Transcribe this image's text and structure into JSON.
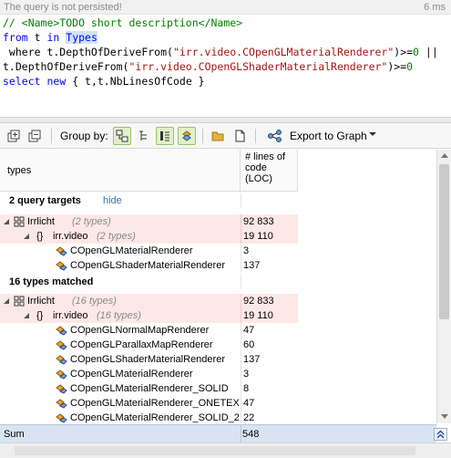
{
  "status": {
    "message": "The query is not persisted!",
    "time": "6 ms"
  },
  "editor": {
    "line1": {
      "comment": "// <Name>TODO short description</Name>"
    },
    "line2": {
      "kw_from": "from",
      "var_t": " t ",
      "kw_in": "in",
      "space": " ",
      "types_sel": "Types"
    },
    "line3": {
      "pre": " where t.DepthOfDeriveFrom(",
      "str": "\"irr.video.COpenGLMaterialRenderer\"",
      "op": ")>=",
      "num": "0",
      "post": " ||"
    },
    "line4": {
      "pre": "t.DepthOfDeriveFrom(",
      "str": "\"irr.video.COpenGLShaderMaterialRenderer\"",
      "op": ")>=",
      "num": "0"
    },
    "line5": {
      "kw_select": "select",
      "space1": " ",
      "kw_new": "new",
      "rest": " { t,t.NbLinesOfCode }"
    }
  },
  "toolbar": {
    "group_by_label": "Group by:",
    "export_label": "Export to Graph"
  },
  "grid": {
    "col_types": "types",
    "col_loc": "# lines of code (LOC)",
    "section1": {
      "title": "2 query targets",
      "hide_link": "hide"
    },
    "targets": [
      {
        "name": "Irrlicht",
        "sub": "(2 types)",
        "loc": "92 833"
      },
      {
        "name": "irr.video",
        "sub": "(2 types)",
        "loc": "19 110"
      },
      {
        "name": "COpenGLMaterialRenderer",
        "loc": "3"
      },
      {
        "name": "COpenGLShaderMaterialRenderer",
        "loc": "137"
      }
    ],
    "section2": {
      "title": "16 types matched"
    },
    "matched": [
      {
        "name": "Irrlicht",
        "sub": "(16 types)",
        "loc": "92 833"
      },
      {
        "name": "irr.video",
        "sub": "(16 types)",
        "loc": "19 110"
      },
      {
        "name": "COpenGLNormalMapRenderer",
        "loc": "47"
      },
      {
        "name": "COpenGLParallaxMapRenderer",
        "loc": "60"
      },
      {
        "name": "COpenGLShaderMaterialRenderer",
        "loc": "137"
      },
      {
        "name": "COpenGLMaterialRenderer",
        "loc": "3"
      },
      {
        "name": "COpenGLMaterialRenderer_SOLID",
        "loc": "8"
      },
      {
        "name": "COpenGLMaterialRenderer_ONETEX",
        "loc": "47"
      },
      {
        "name": "COpenGLMaterialRenderer_SOLID_2",
        "loc": "22"
      }
    ],
    "sum_label": "Sum",
    "sum_value": "548"
  }
}
